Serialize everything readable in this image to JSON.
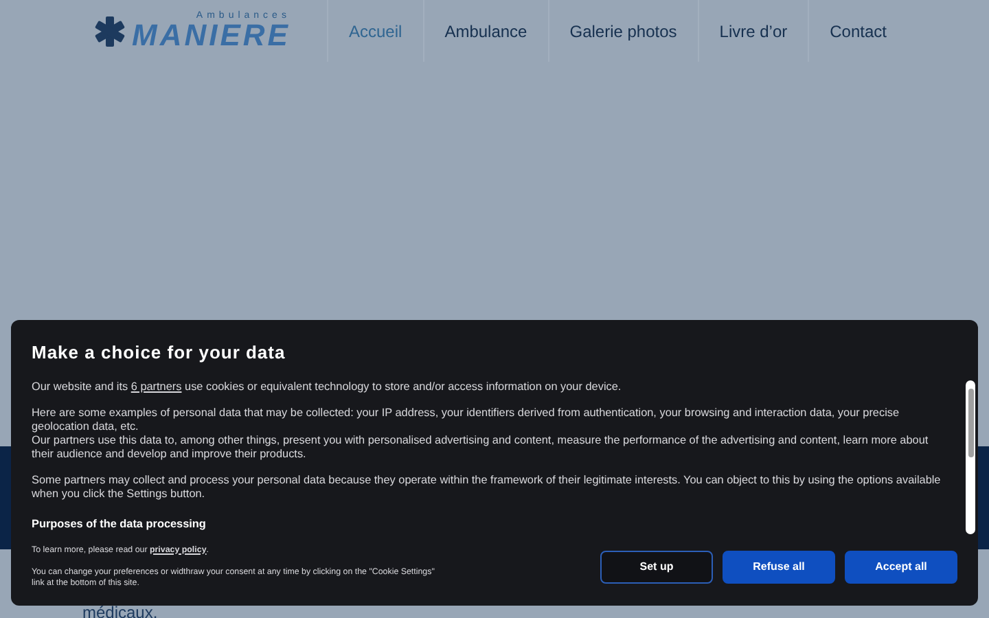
{
  "header": {
    "logo": {
      "top": "Ambulances",
      "main": "MANIERE"
    },
    "nav": [
      {
        "label": "Accueil",
        "selected": true
      },
      {
        "label": "Ambulance",
        "selected": false
      },
      {
        "label": "Galerie photos",
        "selected": false
      },
      {
        "label": "Livre d’or",
        "selected": false
      },
      {
        "label": "Contact",
        "selected": false
      }
    ]
  },
  "page": {
    "paragraph_end": "médicaux."
  },
  "consent_dialog": {
    "title": "Make a choice for your data",
    "intro": {
      "before": "Our website and its ",
      "link": "6 partners",
      "after": " use cookies or equivalent technology to store and/or access information on your device."
    },
    "paragraphs": [
      "Here are some examples of personal data that may be collected: your IP address, your identifiers derived from authentication, your browsing and interaction data, your precise geolocation data, etc.\nOur partners use this data to, among other things, present you with personalised advertising and content, measure the performance of the advertising and content, learn more about their audience and develop and improve their products.",
      "Some partners may collect and process your personal data because they operate within the framework of their legitimate interests. You can object to this by using the options available when you click the Settings button."
    ],
    "section_title": "Purposes of the data processing",
    "privacy": {
      "before": "To learn more, please read our ",
      "link": "privacy policy",
      "after": "."
    },
    "footer_note": "You can change your preferences or widthraw your consent at any time by clicking on the \"Cookie Settings\" link at the bottom of this site.",
    "buttons": [
      {
        "label": "Set up",
        "kind": "outline"
      },
      {
        "label": "Refuse all",
        "kind": "filled"
      },
      {
        "label": "Accept all",
        "kind": "filled"
      }
    ]
  }
}
